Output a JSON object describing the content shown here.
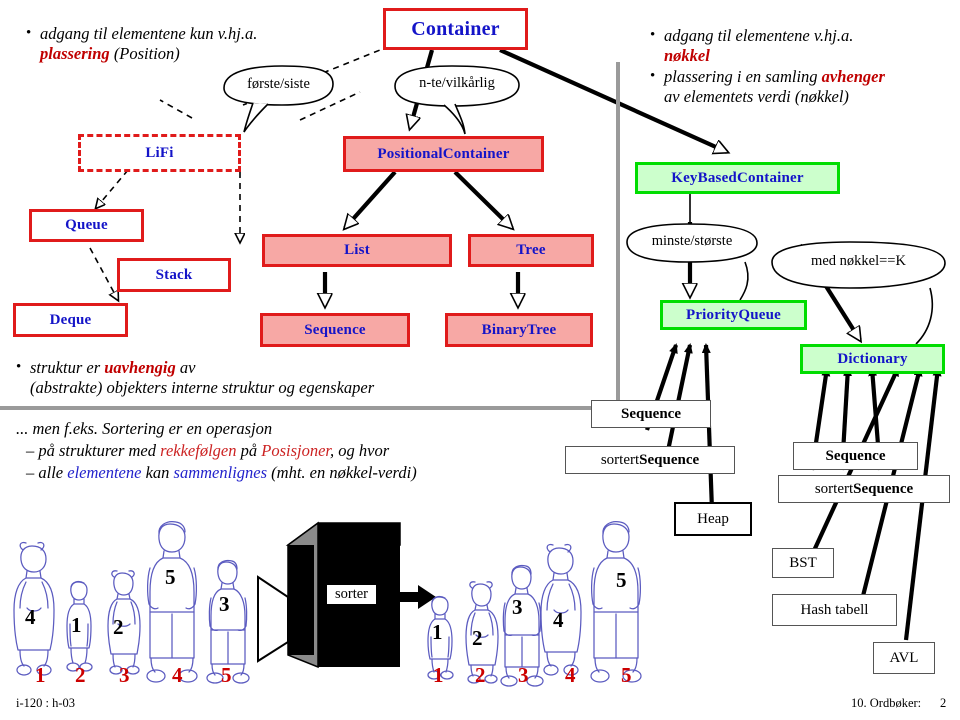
{
  "slide": {
    "footer_left": "i-120 : h-03",
    "footer_right": "10. Ordbøker:",
    "footer_page": "2"
  },
  "notes": {
    "left": {
      "line1_pre": "adgang til elementene kun v.hj.a.",
      "line2_red": "plassering",
      "line2_post": "(Position)"
    },
    "right": {
      "line1": "adgang til elementene v.hj.a.",
      "line1_red": "nøkkel",
      "line2_pre": "plassering i en samling",
      "line2_red": "avhenger",
      "line3": "av elementets verdi (nøkkel)"
    },
    "bottom_left": {
      "b1_pre": "struktur er",
      "b1_red": "uavhengig",
      "b1_post": "av",
      "b1_line2": "(abstrakte) objekters interne struktur og egenskaper",
      "b2": "... men f.eks. Sortering er en operasjon",
      "b3_pre": "– på strukturer med",
      "b3_red1": "rekkefølgen",
      "b3_mid": "på",
      "b3_red2": "Posisjoner",
      "b3_post": ", og hvor",
      "b4_pre": "– alle",
      "b4_blue1": "elementene",
      "b4_mid": "kan",
      "b4_blue2": "sammenlignes",
      "b4_post": "(mht. en nøkkel-verdi)"
    }
  },
  "classes": [
    {
      "id": "container",
      "label": "Container",
      "style": "white"
    },
    {
      "id": "lifi",
      "label": "LiFi",
      "style": "dashed"
    },
    {
      "id": "positional-container",
      "label": "PositionalContainer",
      "style": "pink"
    },
    {
      "id": "keybased-container",
      "label": "KeyBasedContainer",
      "style": "green"
    },
    {
      "id": "queue",
      "label": "Queue",
      "style": "white"
    },
    {
      "id": "stack",
      "label": "Stack",
      "style": "white"
    },
    {
      "id": "deque",
      "label": "Deque",
      "style": "white"
    },
    {
      "id": "list",
      "label": "List",
      "style": "pink"
    },
    {
      "id": "tree",
      "label": "Tree",
      "style": "pink"
    },
    {
      "id": "sequence",
      "label": "Sequence",
      "style": "pink"
    },
    {
      "id": "binarytree",
      "label": "BinaryTree",
      "style": "pink"
    },
    {
      "id": "priorityqueue",
      "label": "PriorityQueue",
      "style": "green"
    },
    {
      "id": "dictionary",
      "label": "Dictionary",
      "style": "green"
    }
  ],
  "bubbles": [
    {
      "id": "forste-siste",
      "label": "første/siste"
    },
    {
      "id": "nte-vilkarlig",
      "label": "n-te/vilkårlig"
    },
    {
      "id": "minste-storste",
      "label": "minste/største"
    },
    {
      "id": "med-nokkel",
      "label": "med nøkkel==K"
    }
  ],
  "impl_boxes": {
    "pq_sequence": "Sequence",
    "pq_sorted_pre": "sortert ",
    "pq_sorted_bold": "Sequence",
    "heap": "Heap",
    "dict_sequence": "Sequence",
    "dict_sorted_pre": "sortert ",
    "dict_sorted_bold": "Sequence",
    "bst": "BST",
    "hash": "Hash tabell",
    "avl": "AVL"
  },
  "sorter": {
    "machine_label": "sorter",
    "input_values": [
      "4",
      "1",
      "2",
      "5",
      "3"
    ],
    "input_positions": [
      "1",
      "2",
      "3",
      "4",
      "5"
    ],
    "output_values": [
      "1",
      "2",
      "3",
      "4",
      "5"
    ],
    "output_positions": [
      "1",
      "2",
      "3",
      "4",
      "5"
    ]
  },
  "colors": {
    "class_text": "#1414c8",
    "red_border": "#e01b1b",
    "pink_fill": "#f7a8a5",
    "green_border": "#00dd00",
    "green_fill": "#ccffcc",
    "accent_red": "#c00000",
    "gray_rule": "#9a9a9a",
    "figure_outline": "#5b5bc0"
  }
}
